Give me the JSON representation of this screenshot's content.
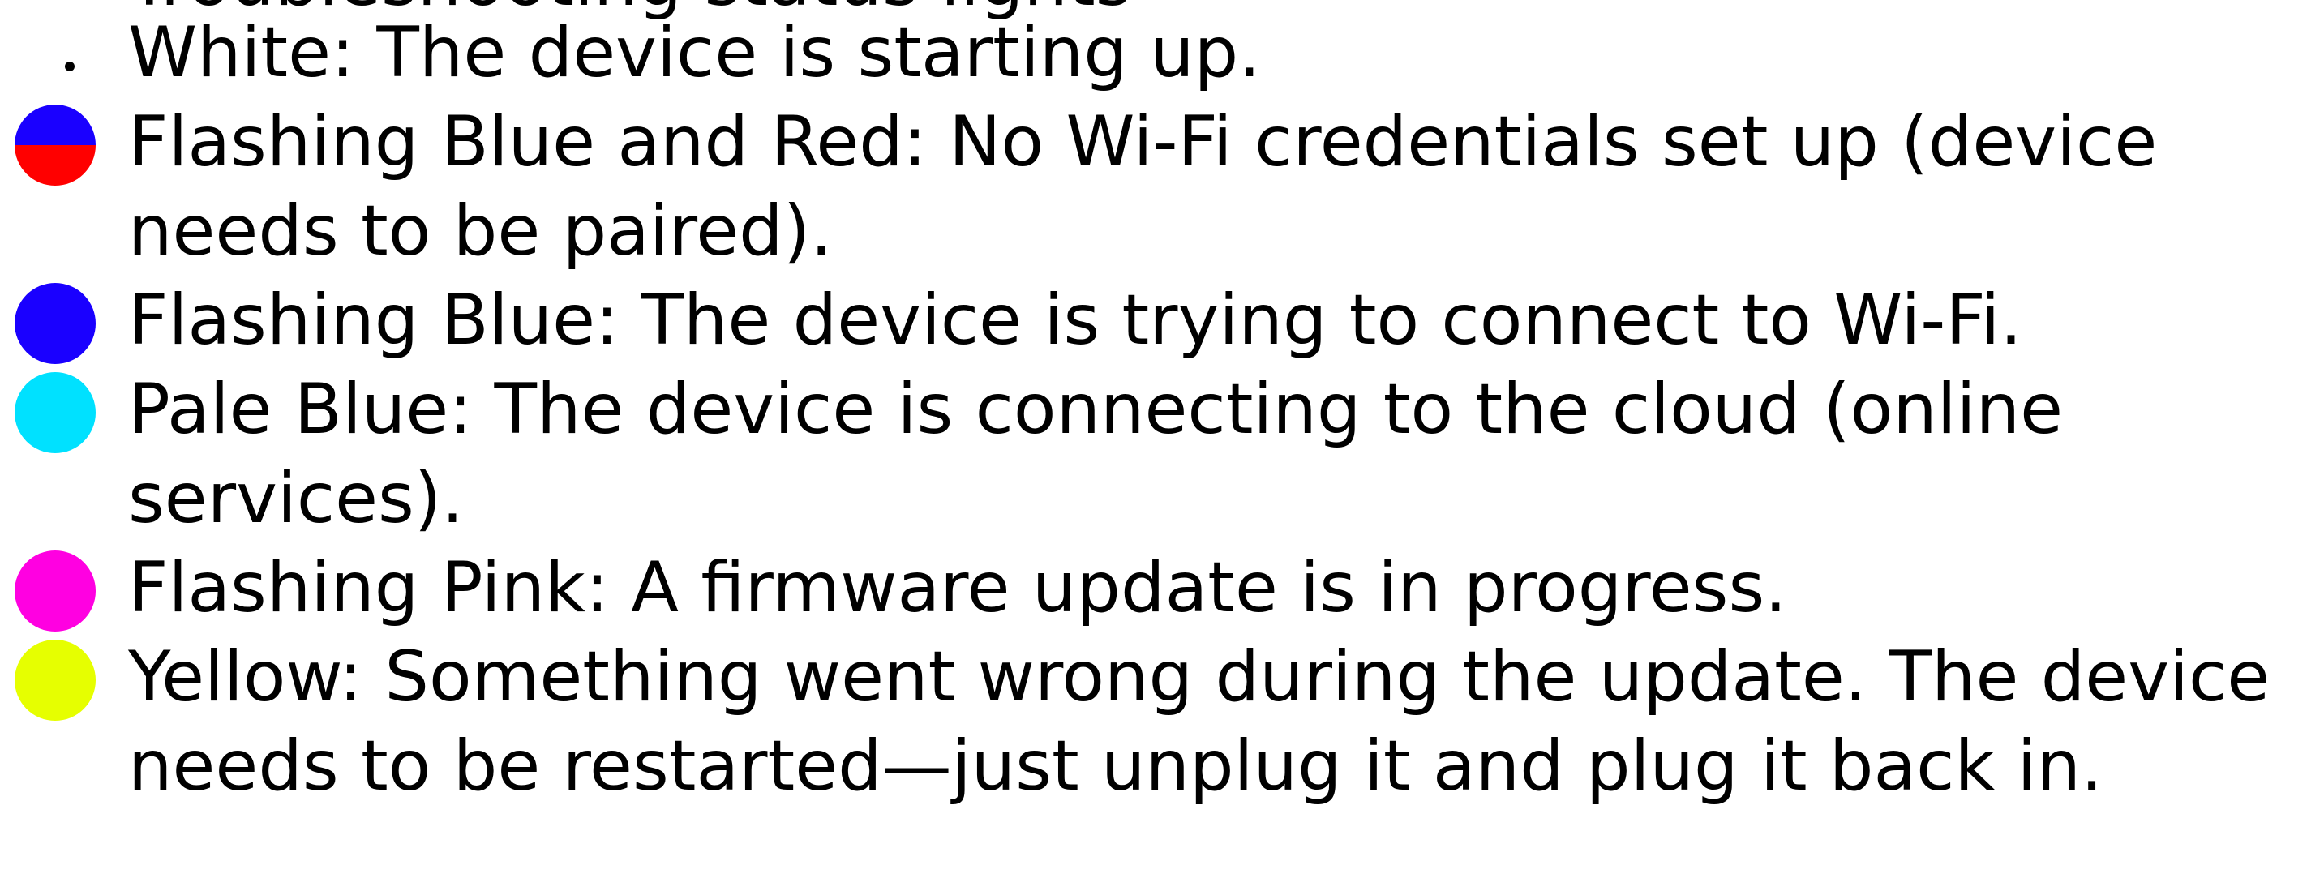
{
  "header_fragment": "Troubleshooting status lights",
  "status_items": [
    {
      "text": "White: The device is starting up.",
      "indicator": "bullet",
      "colors": [
        "#000000"
      ]
    },
    {
      "text": "Flashing Blue and Red: No Wi-Fi credentials set up (device needs to be paired).",
      "indicator": "split-dot",
      "colors": [
        "#1a00ff",
        "#ff0000"
      ]
    },
    {
      "text": "Flashing Blue: The device is trying to connect to Wi-Fi.",
      "indicator": "dot",
      "colors": [
        "#1a00ff"
      ]
    },
    {
      "text": "Pale Blue: The device is connecting to the cloud (online services).",
      "indicator": "dot",
      "colors": [
        "#00e1ff"
      ]
    },
    {
      "text": "Flashing Pink: A firmware update is in progress.",
      "indicator": "dot",
      "colors": [
        "#ff00e1"
      ]
    },
    {
      "text": "Yellow: Something went wrong during the update. The device needs to be restarted—just unplug it and plug it back in.",
      "indicator": "dot",
      "colors": [
        "#e6ff00"
      ]
    }
  ]
}
